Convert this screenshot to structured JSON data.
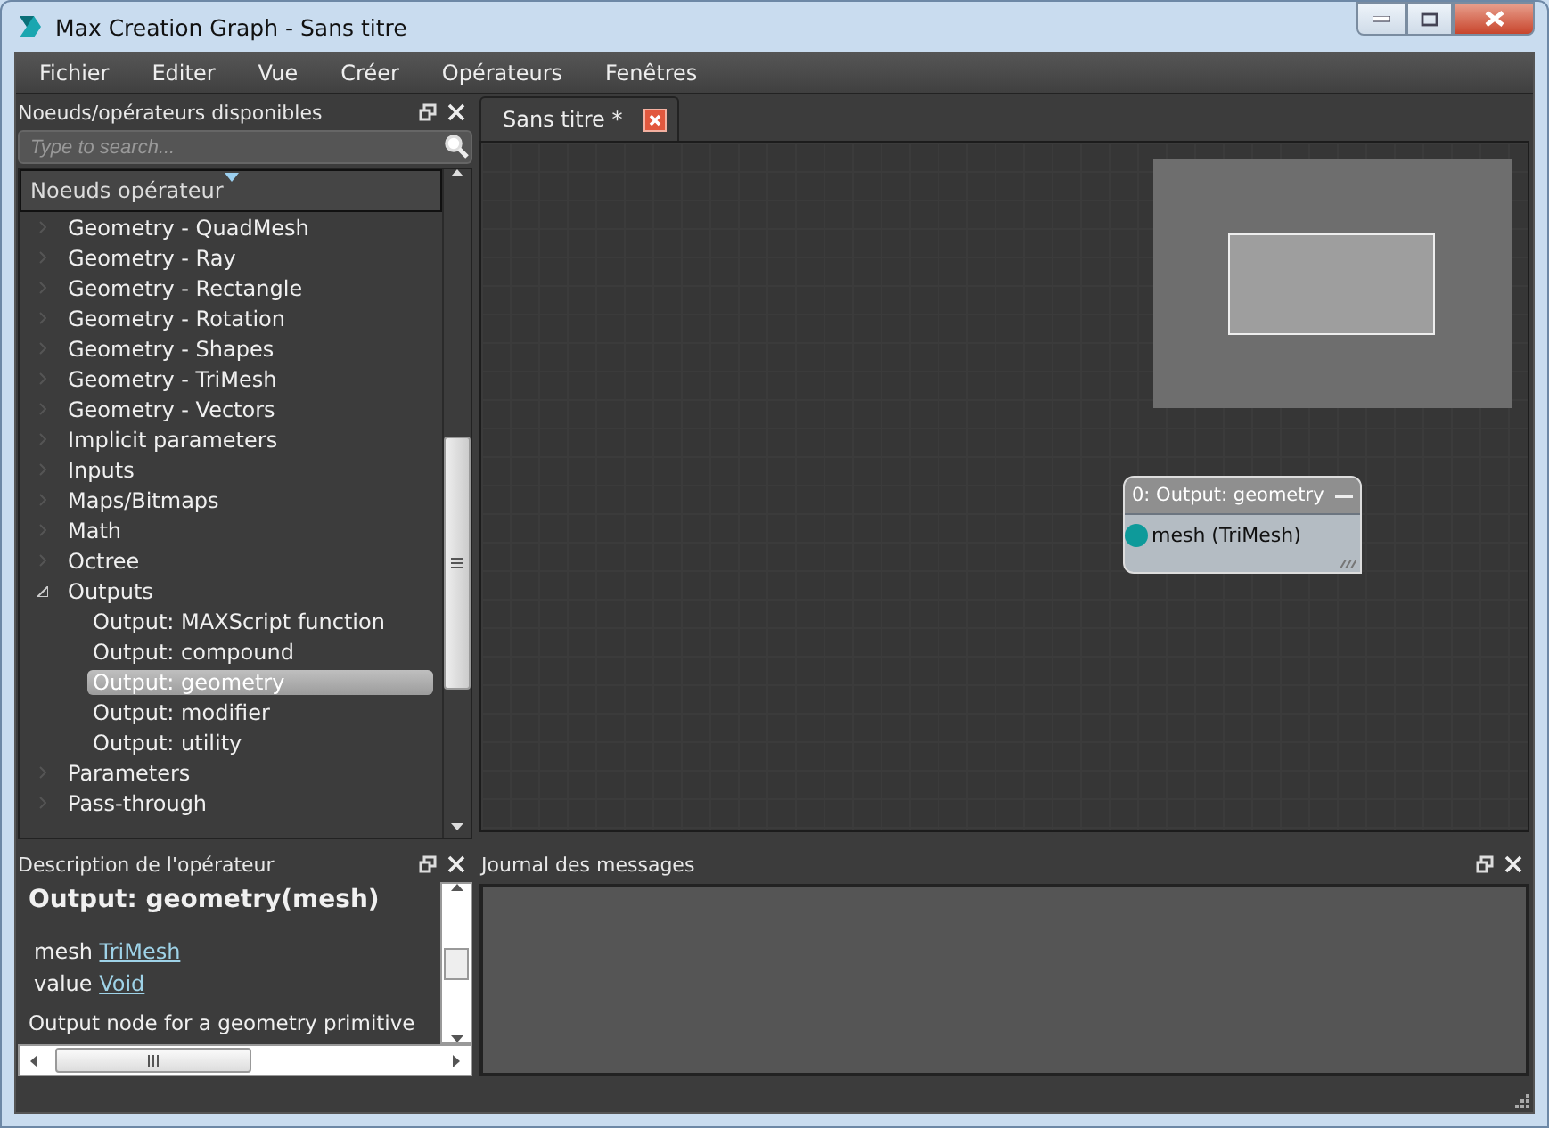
{
  "window": {
    "title": "Max Creation Graph - Sans titre"
  },
  "menu": [
    "Fichier",
    "Editer",
    "Vue",
    "Créer",
    "Opérateurs",
    "Fenêtres"
  ],
  "nodes_panel": {
    "title": "Noeuds/opérateurs disponibles",
    "search": {
      "placeholder": "Type to search..."
    },
    "header": "Noeuds opérateur",
    "tree": [
      {
        "label": "Geometry - QuadMesh",
        "expanded": false,
        "selected": false
      },
      {
        "label": "Geometry - Ray",
        "expanded": false,
        "selected": false
      },
      {
        "label": "Geometry - Rectangle",
        "expanded": false,
        "selected": false
      },
      {
        "label": "Geometry - Rotation",
        "expanded": false,
        "selected": false
      },
      {
        "label": "Geometry - Shapes",
        "expanded": false,
        "selected": false
      },
      {
        "label": "Geometry - TriMesh",
        "expanded": false,
        "selected": false
      },
      {
        "label": "Geometry - Vectors",
        "expanded": false,
        "selected": false
      },
      {
        "label": "Implicit parameters",
        "expanded": false,
        "selected": false
      },
      {
        "label": "Inputs",
        "expanded": false,
        "selected": false
      },
      {
        "label": "Maps/Bitmaps",
        "expanded": false,
        "selected": false
      },
      {
        "label": "Math",
        "expanded": false,
        "selected": false
      },
      {
        "label": "Octree",
        "expanded": false,
        "selected": false
      },
      {
        "label": "Outputs",
        "expanded": true,
        "selected": false,
        "children": [
          {
            "label": "Output: MAXScript function",
            "selected": false
          },
          {
            "label": "Output: compound",
            "selected": false
          },
          {
            "label": "Output: geometry",
            "selected": true
          },
          {
            "label": "Output: modifier",
            "selected": false
          },
          {
            "label": "Output: utility",
            "selected": false
          }
        ]
      },
      {
        "label": "Parameters",
        "expanded": false,
        "selected": false
      },
      {
        "label": "Pass-through",
        "expanded": false,
        "selected": false
      }
    ]
  },
  "tabs": [
    {
      "label": "Sans titre *",
      "selected": true
    }
  ],
  "graph_node": {
    "title": "0: Output: geometry",
    "ports": [
      {
        "label": "mesh (TriMesh)",
        "color": "#0e9a9a"
      }
    ]
  },
  "description_panel": {
    "title": "Description de l'opérateur",
    "heading": "Output: geometry(mesh)",
    "params": [
      {
        "name": "mesh",
        "type": "TriMesh"
      },
      {
        "name": "value",
        "type": "Void"
      }
    ],
    "text": "Output node for a geometry primitive"
  },
  "log_panel": {
    "title": "Journal des messages"
  }
}
